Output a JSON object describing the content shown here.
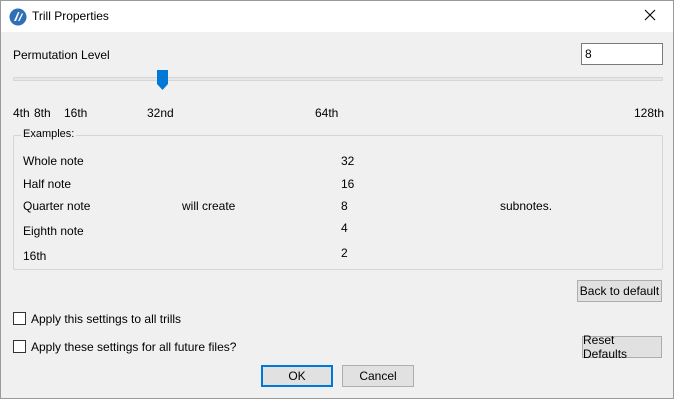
{
  "window": {
    "title": "Trill Properties",
    "icons": {
      "app": "app-icon",
      "close": "close-icon"
    }
  },
  "permutation": {
    "label": "Permutation Level",
    "value": "8"
  },
  "slider": {
    "ticks": [
      "4th",
      "8th",
      "16th",
      "32nd",
      "64th",
      "128th"
    ],
    "selected": "32nd",
    "accent_color": "#0078d7"
  },
  "examples": {
    "legend": "Examples:",
    "rows": [
      {
        "note": "Whole note",
        "count": "32"
      },
      {
        "note": "Half note",
        "count": "16"
      },
      {
        "note": "Quarter note",
        "count": "8"
      },
      {
        "note": "Eighth note",
        "count": "4"
      },
      {
        "note": "16th",
        "count": "2"
      }
    ],
    "will_create": "will create",
    "subnotes": "subnotes."
  },
  "buttons": {
    "back_to_default": "Back to default",
    "reset_defaults": "Reset Defaults",
    "ok": "OK",
    "cancel": "Cancel"
  },
  "options": {
    "apply_all_trills": {
      "label": "Apply this settings to all trills",
      "checked": false
    },
    "apply_future_files": {
      "label": "Apply these settings for all future files?",
      "checked": false
    }
  }
}
